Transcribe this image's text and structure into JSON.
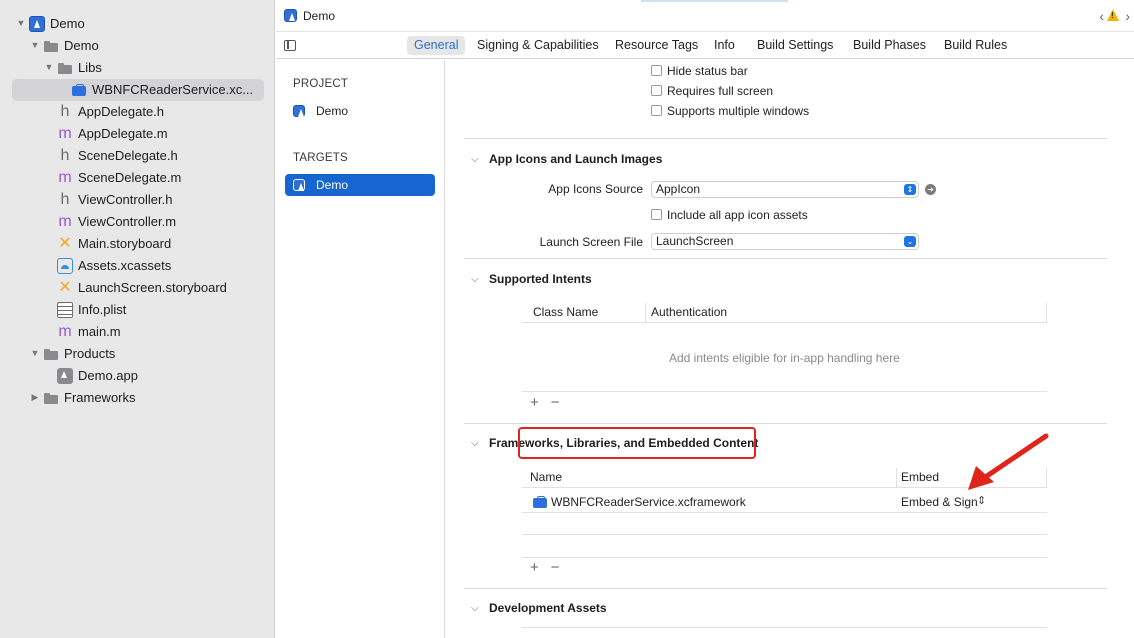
{
  "navigator": {
    "items": [
      {
        "label": "Demo",
        "icon": "app-project-icon"
      },
      {
        "label": "Demo",
        "icon": "folder-icon"
      },
      {
        "label": "Libs",
        "icon": "folder-icon"
      },
      {
        "label": "WBNFCReaderService.xc...",
        "icon": "xcframework-icon"
      },
      {
        "label": "AppDelegate.h",
        "icon": "header-file-icon"
      },
      {
        "label": "AppDelegate.m",
        "icon": "objc-file-icon"
      },
      {
        "label": "SceneDelegate.h",
        "icon": "header-file-icon"
      },
      {
        "label": "SceneDelegate.m",
        "icon": "objc-file-icon"
      },
      {
        "label": "ViewController.h",
        "icon": "header-file-icon"
      },
      {
        "label": "ViewController.m",
        "icon": "objc-file-icon"
      },
      {
        "label": "Main.storyboard",
        "icon": "storyboard-icon"
      },
      {
        "label": "Assets.xcassets",
        "icon": "assets-icon"
      },
      {
        "label": "LaunchScreen.storyboard",
        "icon": "storyboard-icon"
      },
      {
        "label": "Info.plist",
        "icon": "plist-icon"
      },
      {
        "label": "main.m",
        "icon": "objc-file-icon"
      },
      {
        "label": "Products",
        "icon": "folder-icon"
      },
      {
        "label": "Demo.app",
        "icon": "app-product-icon"
      },
      {
        "label": "Frameworks",
        "icon": "folder-icon"
      }
    ]
  },
  "pathbar": {
    "title": "Demo"
  },
  "tabs": [
    {
      "label": "General"
    },
    {
      "label": "Signing & Capabilities"
    },
    {
      "label": "Resource Tags"
    },
    {
      "label": "Info"
    },
    {
      "label": "Build Settings"
    },
    {
      "label": "Build Phases"
    },
    {
      "label": "Build Rules"
    }
  ],
  "project_list": {
    "project_header": "PROJECT",
    "project_item": "Demo",
    "targets_header": "TARGETS",
    "target_item": "Demo"
  },
  "deployment": {
    "hide_status_bar": "Hide status bar",
    "requires_full_screen": "Requires full screen",
    "supports_multiple_windows": "Supports multiple windows"
  },
  "app_icons": {
    "title": "App Icons and Launch Images",
    "source_label": "App Icons Source",
    "source_value": "AppIcon",
    "include_all": "Include all app icon assets",
    "launch_label": "Launch Screen File",
    "launch_value": "LaunchScreen"
  },
  "intents": {
    "title": "Supported Intents",
    "col_class": "Class Name",
    "col_auth": "Authentication",
    "empty": "Add intents eligible for in-app handling here"
  },
  "frameworks": {
    "title": "Frameworks, Libraries, and Embedded Content",
    "col_name": "Name",
    "col_embed": "Embed",
    "row_name": "WBNFCReaderService.xcframework",
    "row_embed": "Embed & Sign"
  },
  "dev_assets": {
    "title": "Development Assets"
  },
  "colors": {
    "accent": "#1765d0",
    "annotation": "#e0241c"
  }
}
